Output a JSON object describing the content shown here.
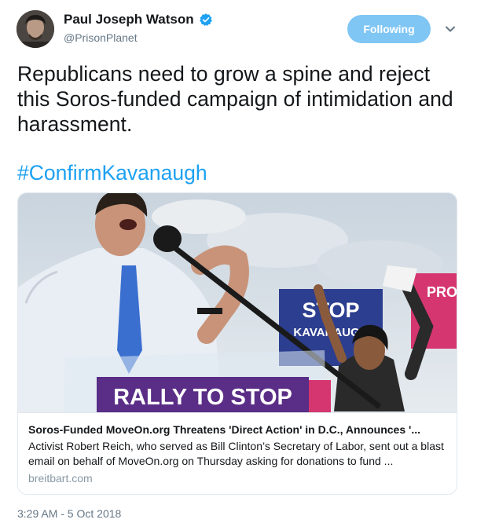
{
  "author": {
    "display_name": "Paul Joseph Watson",
    "handle": "@PrisonPlanet",
    "verified_icon": "verified-badge-icon",
    "avatar_icon": "avatar"
  },
  "follow_button": {
    "label": "Following"
  },
  "tweet": {
    "text": "Republicans need to grow a spine and reject this Soros-funded campaign of intimidation and harassment.",
    "hashtag": "#ConfirmKavanaugh",
    "timestamp": "3:29 AM - 5 Oct 2018"
  },
  "card": {
    "image_banner_text": "RALLY TO STOP",
    "image_sign_text_1": "STOP",
    "image_sign_text_2": "KAVANAUGH",
    "image_sign_text_3": "PROT",
    "title": "Soros-Funded MoveOn.org Threatens 'Direct Action' in D.C., Announces '...",
    "description": "Activist Robert Reich, who served as Bill Clinton’s Secretary of Labor, sent out a blast email on behalf of MoveOn.org on Thursday asking for donations to fund ...",
    "domain": "breitbart.com"
  },
  "colors": {
    "link": "#1da1f2",
    "follow_button_bg": "#7fc6f4",
    "secondary_text": "#657786",
    "banner_purple": "#5a2d86",
    "sign_blue": "#2c3e8f",
    "sign_pink": "#d6366f"
  }
}
